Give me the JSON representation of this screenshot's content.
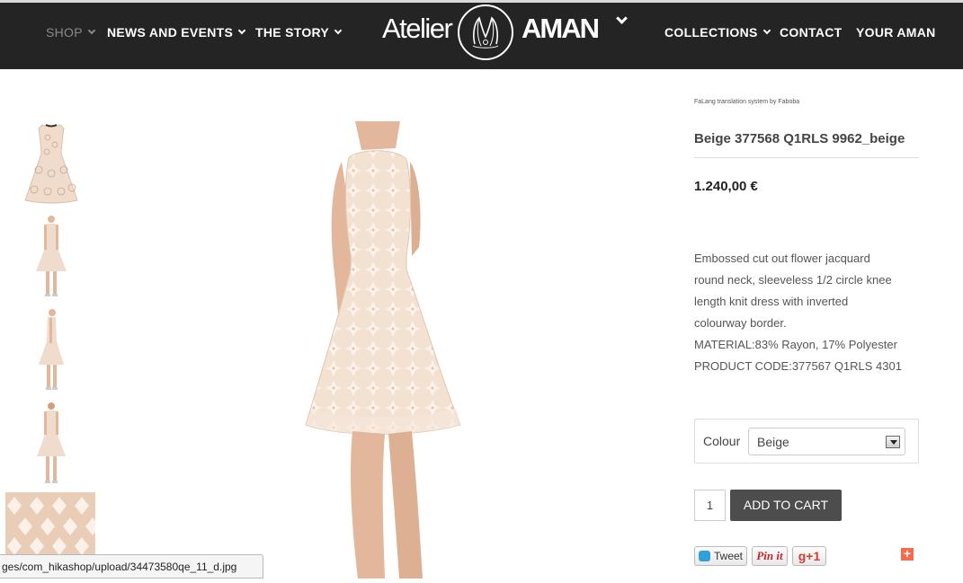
{
  "nav": {
    "left": [
      {
        "label": "SHOP",
        "active": true,
        "dropdown": true
      },
      {
        "label": "NEWS AND EVENTS",
        "dropdown": true
      },
      {
        "label": "THE STORY",
        "dropdown": true
      }
    ],
    "right": [
      {
        "label": "COLLECTIONS",
        "dropdown": true
      },
      {
        "label": "CONTACT"
      },
      {
        "label": "YOUR AMAN"
      }
    ]
  },
  "logo": {
    "left_text": "Atelier",
    "right_text": "AMAN"
  },
  "product": {
    "faleng_note": "FaLang translation system by Faboba",
    "title": "Beige 377568 Q1RLS 9962_beige",
    "price": "1.240,00 €",
    "description": [
      "Embossed cut out flower jacquard",
      "round neck, sleeveless 1/2 circle knee",
      "length knit dress with inverted",
      "colourway border.",
      "MATERIAL:83% Rayon, 17% Polyester",
      "PRODUCT CODE:377567 Q1RLS 4301"
    ],
    "colour_label": "Colour",
    "colour_value": "Beige",
    "quantity": "1",
    "add_to_cart": "ADD TO CART"
  },
  "social": {
    "tweet": "Tweet",
    "pinit": "Pin it",
    "gplus": "g+1",
    "addthis": "+"
  },
  "status_url": "ges/com_hikashop/upload/34473580qe_11_d.jpg",
  "colors": {
    "header_bg": "#242424",
    "button_bg": "#4d4d4d",
    "dress": "#f0dccc",
    "skin": "#e3b79c"
  }
}
